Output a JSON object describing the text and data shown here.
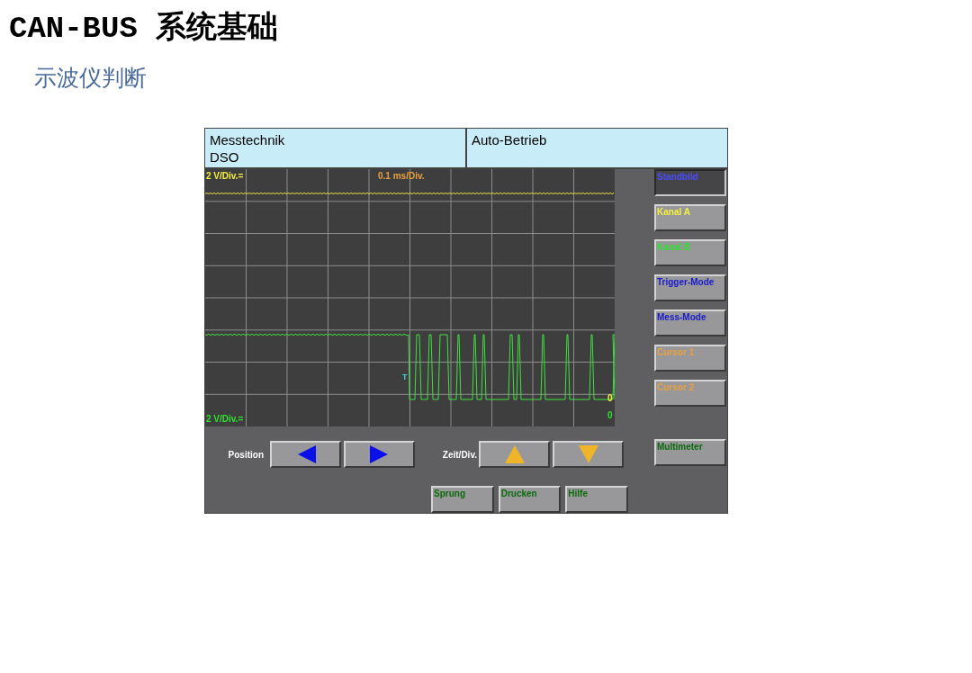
{
  "slide": {
    "title": "CAN-BUS 系统基础",
    "subtitle": "示波仪判断"
  },
  "screen": {
    "header": {
      "section": "Messtechnik",
      "mode": "DSO",
      "status": "Auto-Betrieb"
    },
    "scope": {
      "channel_a_scale": "2 V/Div.=",
      "time_scale": "0.1 ms/Div.",
      "channel_b_scale": "2 V/Div.=",
      "trigger_marker": "T",
      "channel_a_zero": "0",
      "channel_b_zero": "0"
    },
    "side_buttons": [
      {
        "label": "Standbild",
        "kind": "freeze",
        "selected": true
      },
      {
        "label": "Kanal A",
        "kind": "channel_a",
        "selected": false
      },
      {
        "label": "Kanal B",
        "kind": "channel_b",
        "selected": false
      },
      {
        "label": "Trigger-Mode",
        "kind": "mode",
        "selected": false
      },
      {
        "label": "Mess-Mode",
        "kind": "mode",
        "selected": false
      },
      {
        "label": "Cursor 1",
        "kind": "cursor",
        "selected": false
      },
      {
        "label": "Cursor 2",
        "kind": "cursor",
        "selected": false
      }
    ],
    "position": {
      "label": "Position",
      "buttons": [
        {
          "kind": "left",
          "color": "#0a10e8"
        },
        {
          "kind": "right",
          "color": "#0a10e8"
        }
      ]
    },
    "time": {
      "label": "Zeit/Div.",
      "buttons": [
        {
          "kind": "up",
          "color": "#f0b428"
        },
        {
          "kind": "down",
          "color": "#f0b428"
        }
      ]
    },
    "multimeter": {
      "label": "Multimeter"
    },
    "footer_buttons": [
      "Sprung",
      "Drucken",
      "Hilfe"
    ]
  }
}
